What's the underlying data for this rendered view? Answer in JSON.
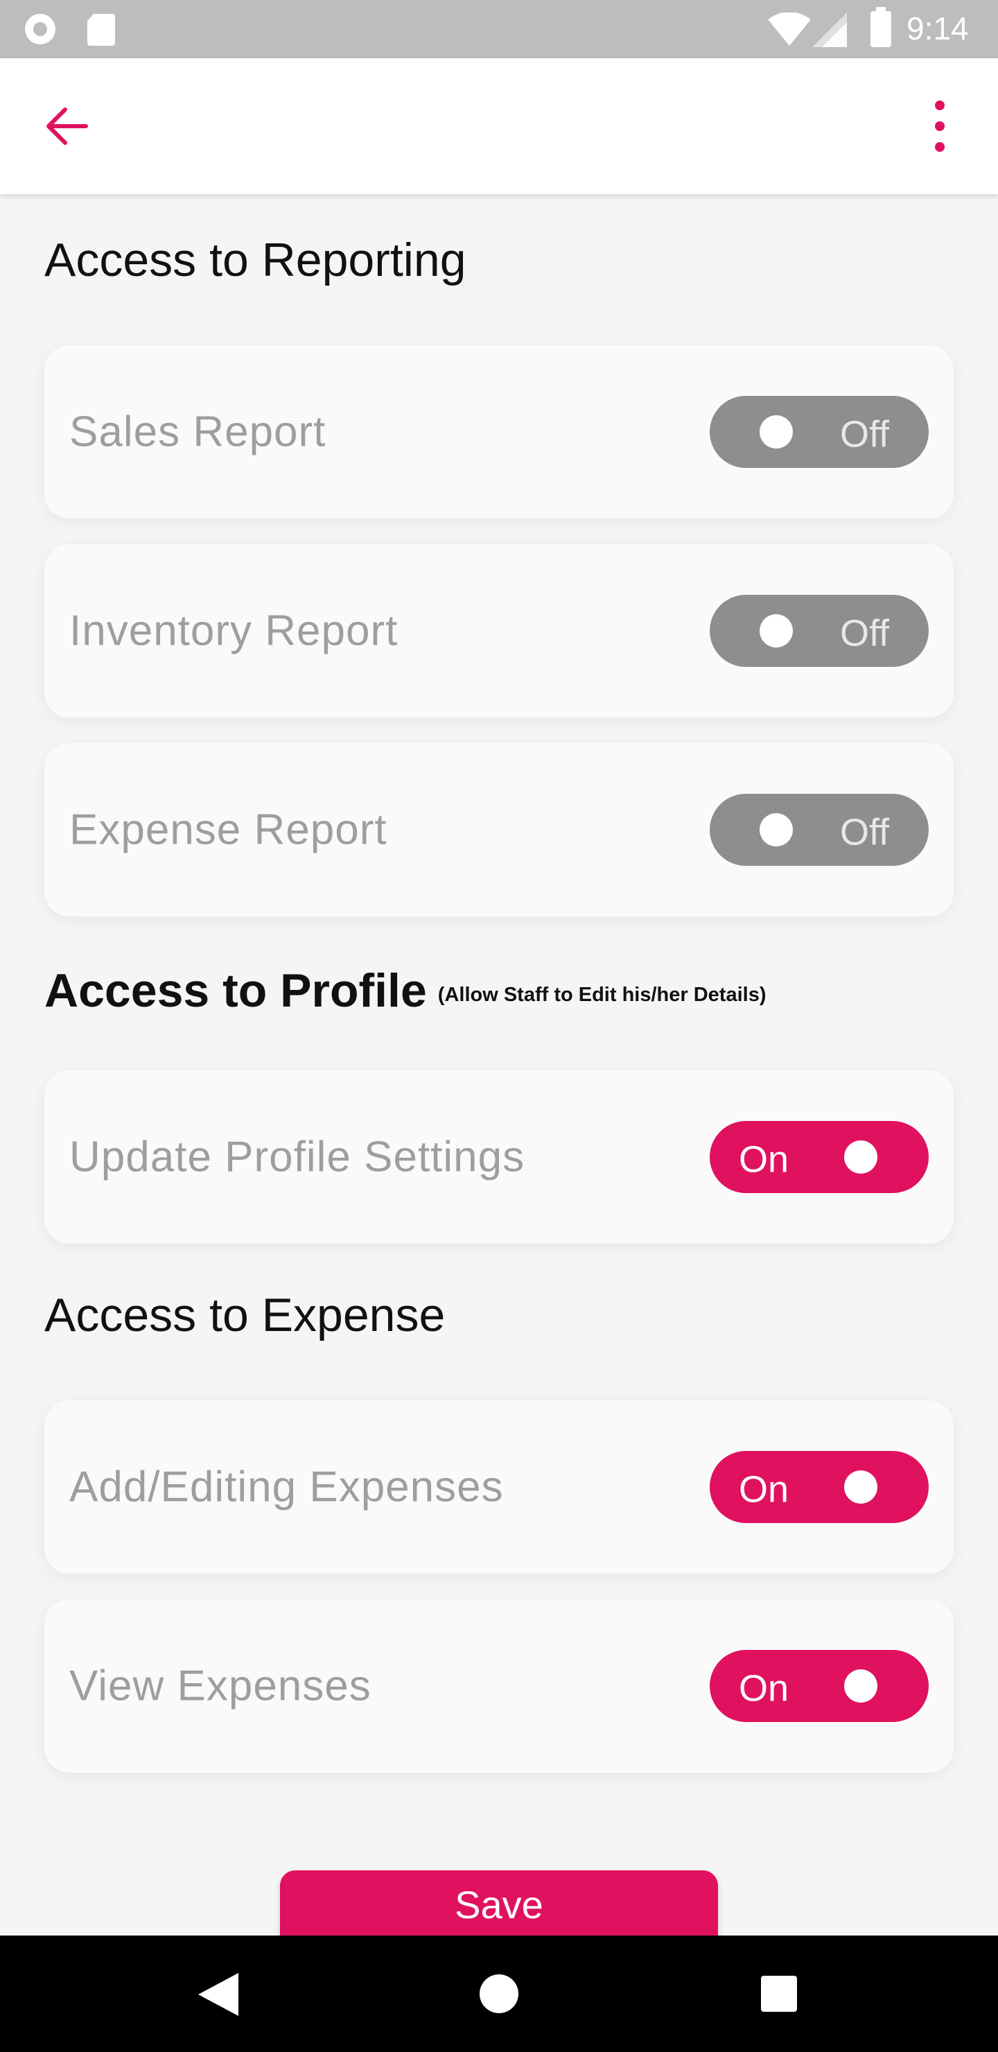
{
  "status_bar": {
    "time": "9:14",
    "icons": [
      "circle-icon",
      "sd-card-icon",
      "wifi-icon",
      "signal-icon",
      "battery-icon"
    ]
  },
  "app_bar": {
    "back_icon": "arrow-left-icon",
    "menu_icon": "more-vert-icon",
    "accent_color": "#e0115f"
  },
  "sections": {
    "reporting": {
      "title": "Access to Reporting",
      "items": [
        {
          "label": "Sales Report",
          "state": "Off"
        },
        {
          "label": "Inventory Report",
          "state": "Off"
        },
        {
          "label": "Expense Report",
          "state": "Off"
        }
      ]
    },
    "profile": {
      "title": "Access to Profile",
      "note": "(Allow Staff to Edit his/her Details)",
      "items": [
        {
          "label": "Update Profile Settings",
          "state": "On"
        }
      ]
    },
    "expense": {
      "title": "Access to Expense",
      "items": [
        {
          "label": "Add/Editing Expenses",
          "state": "On"
        },
        {
          "label": "View Expenses",
          "state": "On"
        }
      ]
    }
  },
  "save_label": "Save",
  "colors": {
    "toggle_on": "#e0115f",
    "toggle_off": "#8e8e8e",
    "background": "#f5f5f5"
  },
  "nav_bar": {
    "icons": [
      "nav-back-icon",
      "nav-home-icon",
      "nav-recents-icon"
    ]
  }
}
